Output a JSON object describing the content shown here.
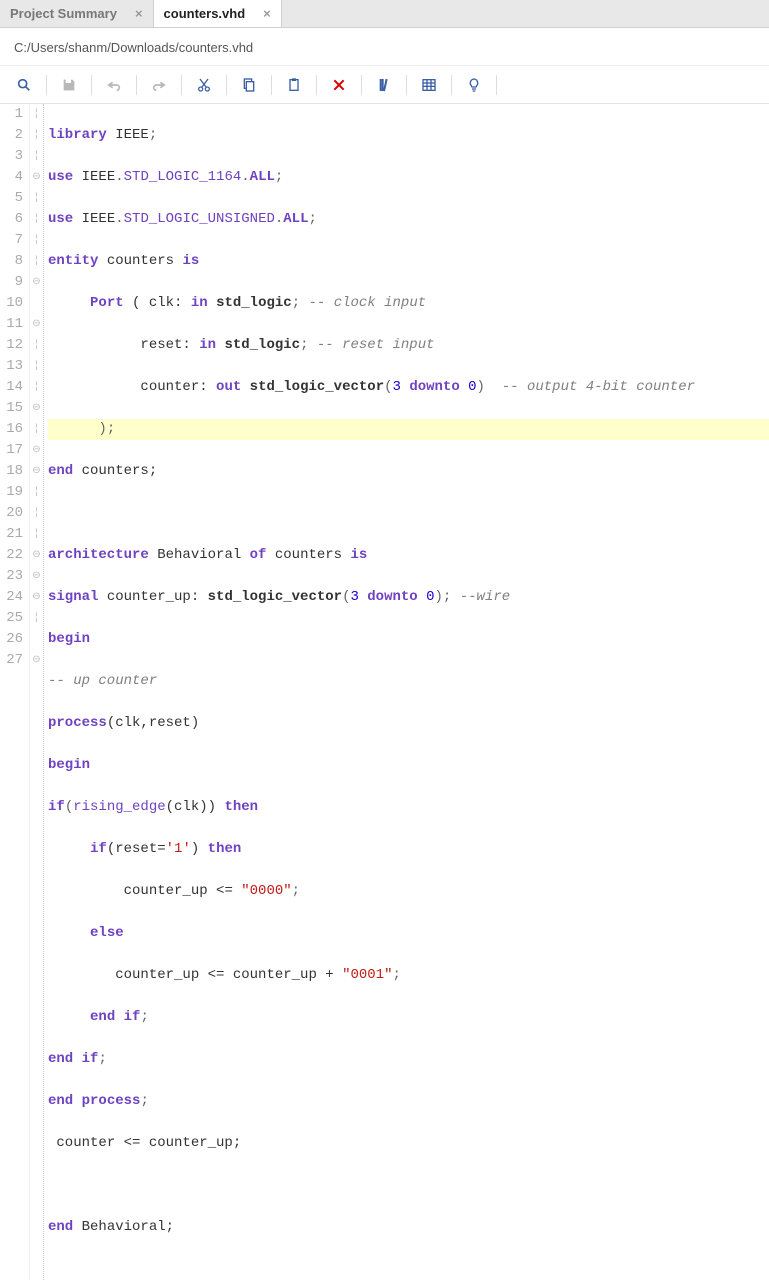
{
  "tabs": [
    {
      "label": "Project Summary",
      "active": false
    },
    {
      "label": "counters.vhd",
      "active": true
    }
  ],
  "filepath": "C:/Users/shanm/Downloads/counters.vhd",
  "toolbar": {
    "search": "search-icon",
    "save": "save-icon",
    "undo": "undo-icon",
    "redo": "redo-icon",
    "cut": "cut-icon",
    "copy": "copy-icon",
    "paste": "paste-icon",
    "delete": "delete-icon",
    "comment": "comment-icon",
    "columns": "columns-icon",
    "hint": "hint-icon"
  },
  "code": {
    "l1": {
      "a": "library",
      "b": " IEEE",
      "c": ";"
    },
    "l2": {
      "a": "use",
      "b": " IEEE",
      "c": ".",
      "d": "STD_LOGIC_1164",
      "e": ".",
      "f": "ALL",
      "g": ";"
    },
    "l3": {
      "a": "use",
      "b": " IEEE",
      "c": ".",
      "d": "STD_LOGIC_UNSIGNED",
      "e": ".",
      "f": "ALL",
      "g": ";"
    },
    "l4": {
      "a": "entity",
      "b": " counters ",
      "c": "is"
    },
    "l5": {
      "pad": "     ",
      "a": "Port",
      "b": " ( clk: ",
      "c": "in",
      "d": " ",
      "e": "std_logic",
      "f": "; ",
      "g": "-- clock input"
    },
    "l6": {
      "pad": "           ",
      "a": "reset: ",
      "b": "in",
      "c": " ",
      "d": "std_logic",
      "e": "; ",
      "f": "-- reset input"
    },
    "l7": {
      "pad": "           ",
      "a": "counter: ",
      "b": "out",
      "c": " ",
      "d": "std_logic_vector",
      "e": "(",
      "f": "3",
      "g": " ",
      "h": "downto",
      "i": " ",
      "j": "0",
      "k": ")  ",
      "l": "-- output 4-bit counter"
    },
    "l8": {
      "pad": "      ",
      "a": ");"
    },
    "l9": {
      "a": "end",
      "b": " counters;"
    },
    "l11": {
      "a": "architecture",
      "b": " Behavioral ",
      "c": "of",
      "d": " counters ",
      "e": "is"
    },
    "l12": {
      "a": "signal",
      "b": " counter_up: ",
      "c": "std_logic_vector",
      "d": "(",
      "e": "3",
      "f": " ",
      "g": "downto",
      "h": " ",
      "i": "0",
      "j": "); ",
      "k": "--wire"
    },
    "l13": {
      "a": "begin"
    },
    "l14": {
      "a": "-- up counter"
    },
    "l15": {
      "a": "process",
      "b": "(clk,reset)"
    },
    "l16": {
      "a": "begin"
    },
    "l17": {
      "a": "if",
      "b": "(",
      "c": "rising_edge",
      "d": "(clk)) ",
      "e": "then"
    },
    "l18": {
      "pad": "     ",
      "a": "if",
      "b": "(reset=",
      "c": "'1'",
      "d": ") ",
      "e": "then"
    },
    "l19": {
      "pad": "         ",
      "a": "counter_up <= ",
      "b": "\"0000\"",
      "c": ";"
    },
    "l20": {
      "pad": "     ",
      "a": "else"
    },
    "l21": {
      "pad": "        ",
      "a": "counter_up <= counter_up + ",
      "b": "\"0001\"",
      "c": ";"
    },
    "l22": {
      "pad": "     ",
      "a": "end",
      "b": " ",
      "c": "if",
      "d": ";"
    },
    "l23": {
      "a": "end",
      "b": " ",
      "c": "if",
      "d": ";"
    },
    "l24": {
      "a": "end",
      "b": " ",
      "c": "process",
      "d": ";"
    },
    "l25": {
      "pad": " ",
      "a": "counter <= counter_up;"
    },
    "l27": {
      "a": "end",
      "b": " Behavioral;"
    }
  },
  "linenums": {
    "n1": "1",
    "n2": "2",
    "n3": "3",
    "n4": "4",
    "n5": "5",
    "n6": "6",
    "n7": "7",
    "n8": "8",
    "n9": "9",
    "n10": "10",
    "n11": "11",
    "n12": "12",
    "n13": "13",
    "n14": "14",
    "n15": "15",
    "n16": "16",
    "n17": "17",
    "n18": "18",
    "n19": "19",
    "n20": "20",
    "n21": "21",
    "n22": "22",
    "n23": "23",
    "n24": "24",
    "n25": "25",
    "n26": "26",
    "n27": "27"
  },
  "fold": {
    "open": "⊖",
    "none": "¦"
  }
}
